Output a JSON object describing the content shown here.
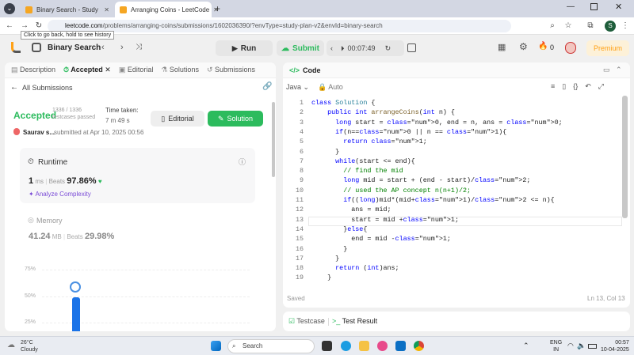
{
  "browser": {
    "tabs": [
      {
        "title": "Binary Search - Study Plan - Lee"
      },
      {
        "title": "Arranging Coins - LeetCode"
      }
    ],
    "url_host": "leetcode.com",
    "url_path": "/problems/arranging-coins/submissions/1602036390/?envType=study-plan-v2&envId=binary-search",
    "back_tooltip": "Click to go back, hold to see history",
    "profile_initial": "S"
  },
  "nav": {
    "study_plan_title": "Binary Search",
    "run_label": "Run",
    "submit_label": "Submit",
    "timer": "00:07:49",
    "coins": "0",
    "premium_label": "Premium"
  },
  "left": {
    "tabs": [
      "Description",
      "Accepted",
      "Editorial",
      "Solutions",
      "Submissions"
    ],
    "back_label": "All Submissions",
    "status": "Accepted",
    "testcases": "1336 / 1336",
    "testcases_label": "testcases passed",
    "time_taken_label": "Time taken:",
    "time_taken": "7 m 49 s",
    "editorial_button": "Editorial",
    "solution_button": "Solution",
    "user": "Saurav s...",
    "submitted": "submitted at Apr 10, 2025 00:56",
    "runtime_label": "Runtime",
    "runtime_value": "1",
    "runtime_unit": "ms",
    "beats_label": "Beats",
    "runtime_beats": "97.86%",
    "analyze_label": "Analyze Complexity",
    "memory_label": "Memory",
    "memory_value": "41.24",
    "memory_unit": "MB",
    "memory_beats": "29.98%",
    "chart_ticks": [
      "75%",
      "50%",
      "25%"
    ]
  },
  "code": {
    "title": "Code",
    "language": "Java",
    "mode": "Auto",
    "saved_label": "Saved",
    "cursor": "Ln 13, Col 13",
    "lines": [
      "class Solution {",
      "    public int arrangeCoins(int n) {",
      "      long start = 0, end = n, ans = 0;",
      "      if(n==0 || n == 1){",
      "        return 1;",
      "      }",
      "      while(start <= end){",
      "        // find the mid",
      "        long mid = start + (end - start)/2;",
      "        // used the AP concept n(n+1)/2;",
      "        if((long)mid*(mid+1)/2 <= n){",
      "          ans = mid;",
      "          start = mid +1;",
      "        }else{",
      "          end = mid -1;",
      "        }",
      "      }",
      "      return (int)ans;",
      "    }"
    ]
  },
  "test": {
    "testcase_label": "Testcase",
    "result_label": "Test Result"
  },
  "taskbar": {
    "temp": "26°C",
    "weather": "Cloudy",
    "search_placeholder": "Search",
    "lang1": "ENG",
    "lang2": "IN",
    "time": "00:57",
    "date": "10-04-2025"
  },
  "colors": {
    "accent_green": "#2cbb5d",
    "premium": "#ffa116",
    "beats_green": "#1e8f3f"
  }
}
